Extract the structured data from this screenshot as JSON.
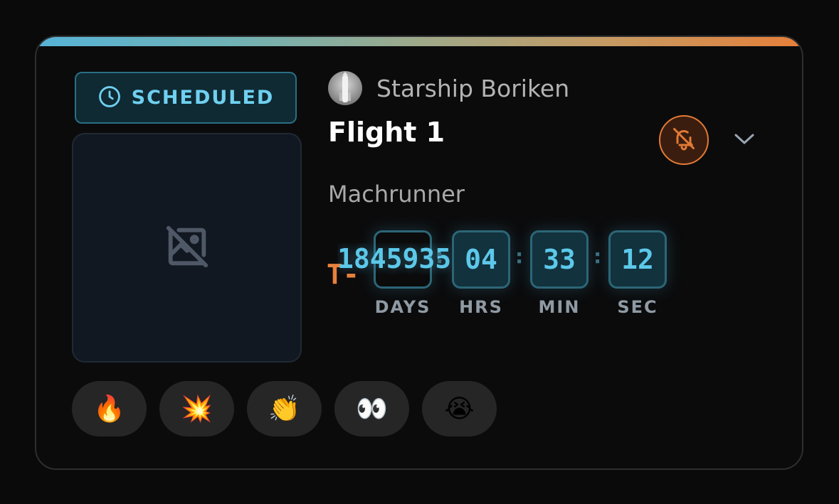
{
  "card": {
    "status": {
      "label": "SCHEDULED",
      "icon": "clock-icon",
      "color": "#6fd0f0"
    },
    "thumbnail": {
      "icon": "image-off-icon"
    },
    "rocket": {
      "name": "Starship Boriken",
      "avatar_icon": "rocket-avatar-icon"
    },
    "mission": {
      "title": "Flight 1"
    },
    "provider": {
      "name": "Machrunner"
    },
    "notifications": {
      "icon": "bell-off-icon",
      "accent": "#e27a36"
    },
    "expand": {
      "icon": "chevron-down-icon"
    },
    "countdown": {
      "prefix": "T-",
      "days_overflow": "1845935",
      "units": [
        {
          "value": "",
          "label": "DAYS"
        },
        {
          "value": "04",
          "label": "HRS"
        },
        {
          "value": "33",
          "label": "MIN"
        },
        {
          "value": "12",
          "label": "SEC"
        }
      ],
      "separator": ":"
    },
    "reactions": [
      {
        "emoji": "🔥",
        "icon": "fire-emoji"
      },
      {
        "emoji": "💥",
        "icon": "collision-emoji"
      },
      {
        "emoji": "👏",
        "icon": "clapping-hands-emoji"
      },
      {
        "emoji": "👀",
        "icon": "eyes-emoji"
      },
      {
        "emoji": "😭",
        "icon": "crying-face-emoji"
      }
    ],
    "gradient": [
      "#56b3d6",
      "#e57f3a"
    ]
  }
}
